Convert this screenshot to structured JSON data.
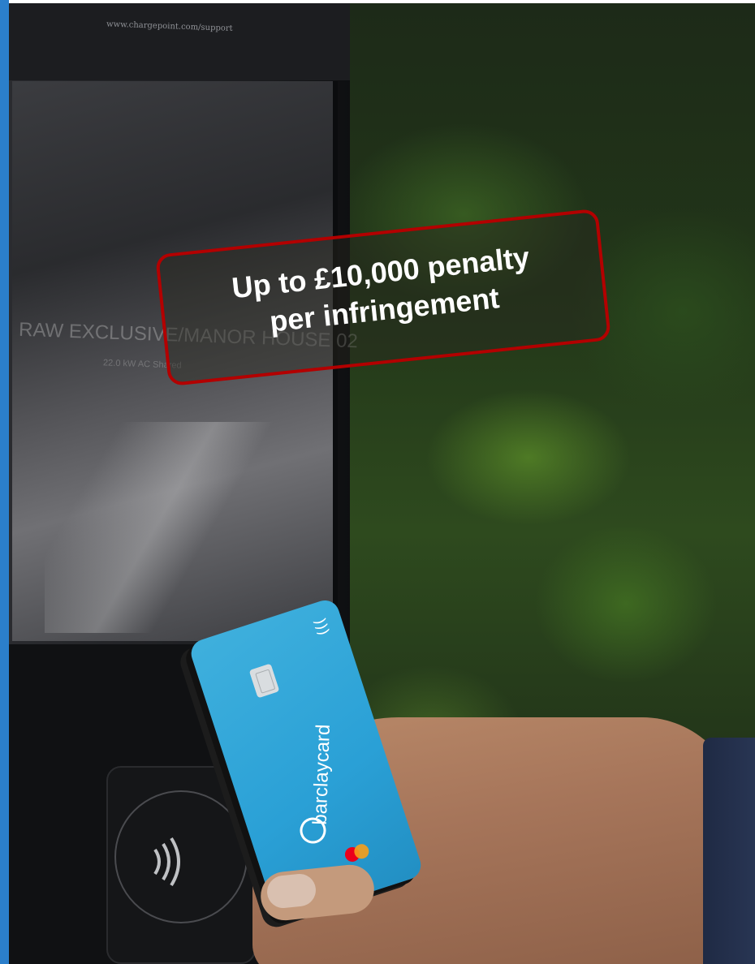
{
  "accent_color": "#2b7fcb",
  "callout": {
    "line1": "Up to £10,000 penalty",
    "line2": "per infringement",
    "border_color": "#b30000"
  },
  "photo": {
    "kiosk_url": "www.chargepoint.com/support",
    "screen_text_1": "RAW EXCLUSIVE/MANOR HOUSE 02",
    "screen_text_2": "22.0 kW AC Shared",
    "card_brand": "barclaycard",
    "card_color": "#2aa0d6",
    "icons": [
      "contactless-icon",
      "chip-icon",
      "mastercard-logo-icon"
    ]
  }
}
